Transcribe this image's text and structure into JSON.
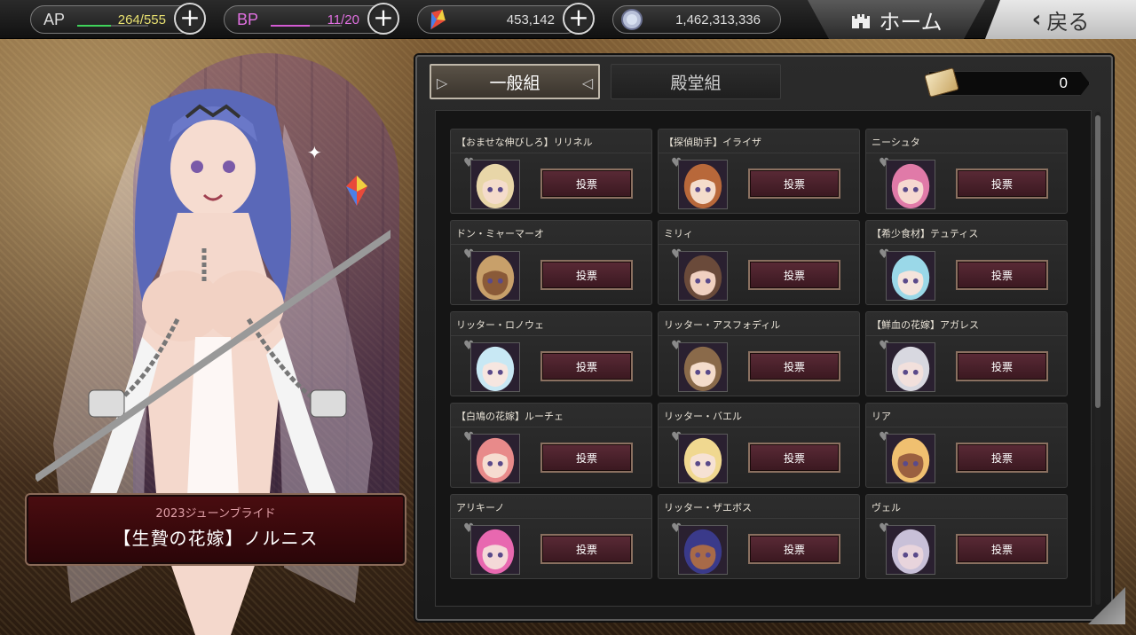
{
  "topbar": {
    "ap": {
      "label": "AP",
      "value": "264/555",
      "fill": 0.48,
      "color": "#3fd25a"
    },
    "bp": {
      "label": "BP",
      "value": "11/20",
      "fill": 0.55,
      "color": "#d25ad2"
    },
    "gems": {
      "value": "453,142"
    },
    "coins": {
      "value": "1,462,313,336"
    },
    "home_label": "ホーム",
    "back_label": "戻る"
  },
  "nameplate": {
    "event": "2023ジューンブライド",
    "name": "【生贄の花嫁】ノルニス"
  },
  "tabs": [
    {
      "label": "一般組",
      "active": true
    },
    {
      "label": "殿堂組",
      "active": false
    }
  ],
  "tickets": {
    "value": "0"
  },
  "vote_label": "投票",
  "cards": [
    {
      "name": "【おませな伸びしろ】リリネル",
      "hair": "#e8d6a8",
      "skin": "#f4dccb"
    },
    {
      "name": "【探偵助手】イライザ",
      "hair": "#b8683a",
      "skin": "#f4dccb"
    },
    {
      "name": "ニーシュタ",
      "hair": "#e07aa8",
      "skin": "#f6d8d0"
    },
    {
      "name": "ドン・ミャーマーオ",
      "hair": "#c8a06a",
      "skin": "#8a5a38"
    },
    {
      "name": "ミリィ",
      "hair": "#6a4a3a",
      "skin": "#f0d0c0"
    },
    {
      "name": "【希少食材】テュティス",
      "hair": "#9ad8e8",
      "skin": "#f4e4dc"
    },
    {
      "name": "リッター・ロノウェ",
      "hair": "#c8e8f4",
      "skin": "#f6e6e0"
    },
    {
      "name": "リッター・アスフォディル",
      "hair": "#8a6a4a",
      "skin": "#f4dccb"
    },
    {
      "name": "【鮮血の花嫁】アガレス",
      "hair": "#d8d8e0",
      "skin": "#f2e0dc"
    },
    {
      "name": "【白鳩の花嫁】ルーチェ",
      "hair": "#e88a8a",
      "skin": "#f6dcd0"
    },
    {
      "name": "リッター・バエル",
      "hair": "#f0d890",
      "skin": "#f6e2d4"
    },
    {
      "name": "リア",
      "hair": "#f0c070",
      "skin": "#9a6040"
    },
    {
      "name": "アリキーノ",
      "hair": "#e868b0",
      "skin": "#f4d8d8"
    },
    {
      "name": "リッター・ザエボス",
      "hair": "#3a3a8a",
      "skin": "#a86a48"
    },
    {
      "name": "ヴェル",
      "hair": "#c8c0d8",
      "skin": "#e8d4dc"
    }
  ]
}
